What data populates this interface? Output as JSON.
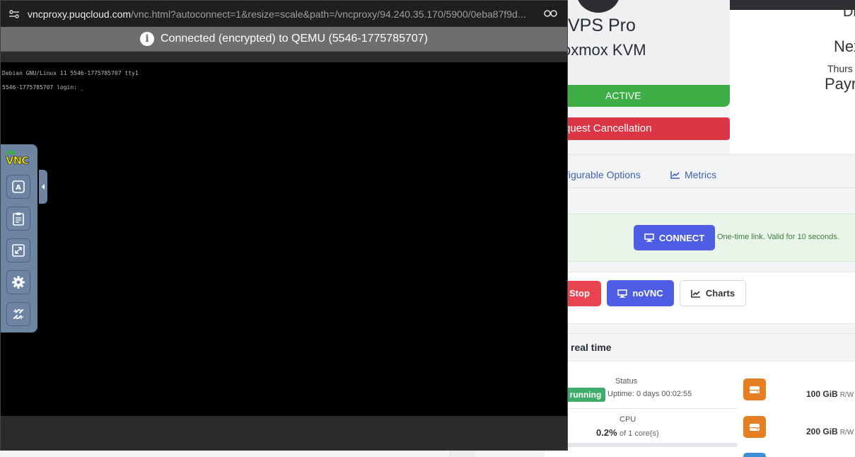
{
  "browser": {
    "url_host": "vncproxy.puqcloud.com",
    "url_path": "/vnc.html?autoconnect=1&resize=scale&path=/vncproxy/94.240.35.170/5900/0eba87f9d..."
  },
  "vnc": {
    "banner": "Connected (encrypted) to QEMU (5546-1775785707)",
    "terminal_lines": [
      "Debian GNU/Linux 11 5546-1775785707 tty1",
      "5546-1775785707 login: _"
    ],
    "logo": {
      "top": "no",
      "bottom": "VNC"
    }
  },
  "service": {
    "product_name": "VPS Pro",
    "product_sub": "oxmox KVM",
    "status": "ACTIVE",
    "cancel_label": "quest Cancellation",
    "right": {
      "line1": "Di",
      "line2": "Nex",
      "line3": "Thurs",
      "line4": "Payr"
    }
  },
  "tabs": [
    {
      "label": "figurable Options"
    },
    {
      "label": "Metrics"
    }
  ],
  "connect": {
    "button_label": "CONNECT",
    "note": "One-time link. Valid for 10 seconds."
  },
  "actions": {
    "stop_label": "Stop",
    "novnc_label": "noVNC",
    "charts_label": "Charts"
  },
  "realtime": {
    "title": "real time",
    "status_label": "Status",
    "running_badge": "running",
    "uptime": "Uptime: 0 days 00:02:55",
    "cpu_label": "CPU",
    "cpu_value": "0.2%",
    "cpu_cores": "of 1 core(s)",
    "disks": [
      {
        "size": "100 GiB",
        "mode": "R/W"
      },
      {
        "size": "200 GiB",
        "mode": "R/W"
      }
    ]
  },
  "colors": {
    "active_green": "#3fad46",
    "cancel_red": "#dc3545",
    "primary_blue": "#4e5ee4",
    "disk_orange": "#e67e22",
    "novnc_panel": "#6e84a3"
  }
}
